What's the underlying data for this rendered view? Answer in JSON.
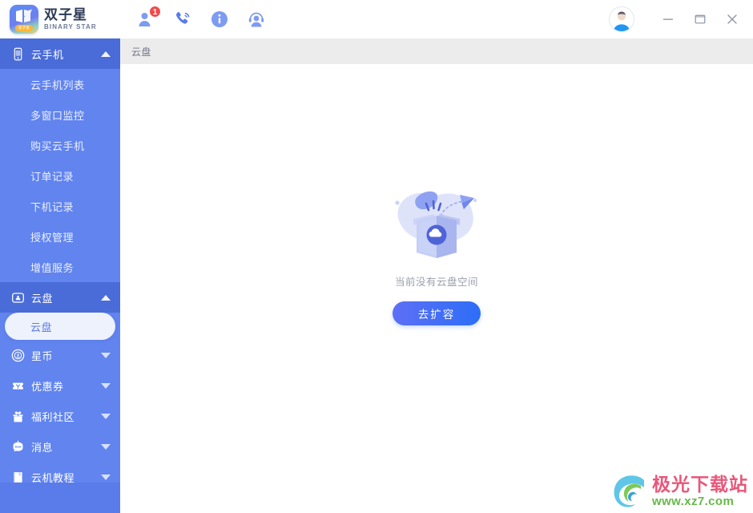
{
  "app": {
    "brand_cn": "双子星",
    "brand_en": "BINARY STAR",
    "logo_badge": "双子星"
  },
  "titlebar": {
    "icons": [
      {
        "name": "contacts-icon",
        "badge": "1"
      },
      {
        "name": "phone-icon",
        "badge": ""
      },
      {
        "name": "info-icon",
        "badge": ""
      },
      {
        "name": "support-headset-icon",
        "badge": ""
      }
    ],
    "avatar_name": "user-avatar",
    "minimize_label": "最小化",
    "maximize_label": "最大化",
    "close_label": "关闭"
  },
  "sidebar": {
    "sections": [
      {
        "label": "云手机",
        "icon": "phone-icon",
        "expanded": true,
        "chevron": "up",
        "items": [
          {
            "label": "云手机列表",
            "active": false
          },
          {
            "label": "多窗口监控",
            "active": false
          },
          {
            "label": "购买云手机",
            "active": false
          },
          {
            "label": "订单记录",
            "active": false
          },
          {
            "label": "下机记录",
            "active": false
          },
          {
            "label": "授权管理",
            "active": false
          },
          {
            "label": "增值服务",
            "active": false
          }
        ]
      },
      {
        "label": "云盘",
        "icon": "cloud-disk-icon",
        "expanded": true,
        "chevron": "up",
        "items": [
          {
            "label": "云盘",
            "active": true
          }
        ]
      },
      {
        "label": "星币",
        "icon": "coin-icon",
        "expanded": false,
        "chevron": "down",
        "items": []
      },
      {
        "label": "优惠券",
        "icon": "ticket-icon",
        "expanded": false,
        "chevron": "down",
        "items": []
      },
      {
        "label": "福利社区",
        "icon": "gift-icon",
        "expanded": false,
        "chevron": "down",
        "items": []
      },
      {
        "label": "消息",
        "icon": "message-icon",
        "expanded": false,
        "chevron": "down",
        "items": []
      },
      {
        "label": "云机教程",
        "icon": "book-icon",
        "expanded": false,
        "chevron": "down",
        "items": []
      }
    ]
  },
  "main": {
    "breadcrumb": "云盘",
    "empty_state": {
      "illustration": "empty-box-cloud-illustration",
      "message": "当前没有云盘空间",
      "button_label": "去扩容"
    }
  },
  "watermark": {
    "name_cn": "极光下载站",
    "url": "www.xz7.com"
  },
  "colors": {
    "sidebar_bg": "#6184ef",
    "sidebar_section_active": "#4a6cd8",
    "sidebar_item_active_bg": "#eef2fd",
    "sidebar_item_active_text": "#5a7bea",
    "breadcrumb_bg": "#ececec",
    "cta_gradient_from": "#5d6ff5",
    "cta_gradient_to": "#2d6ef7",
    "badge_red": "#f04b4b",
    "watermark_pink": "#e8577a",
    "watermark_green": "#66b84a"
  }
}
